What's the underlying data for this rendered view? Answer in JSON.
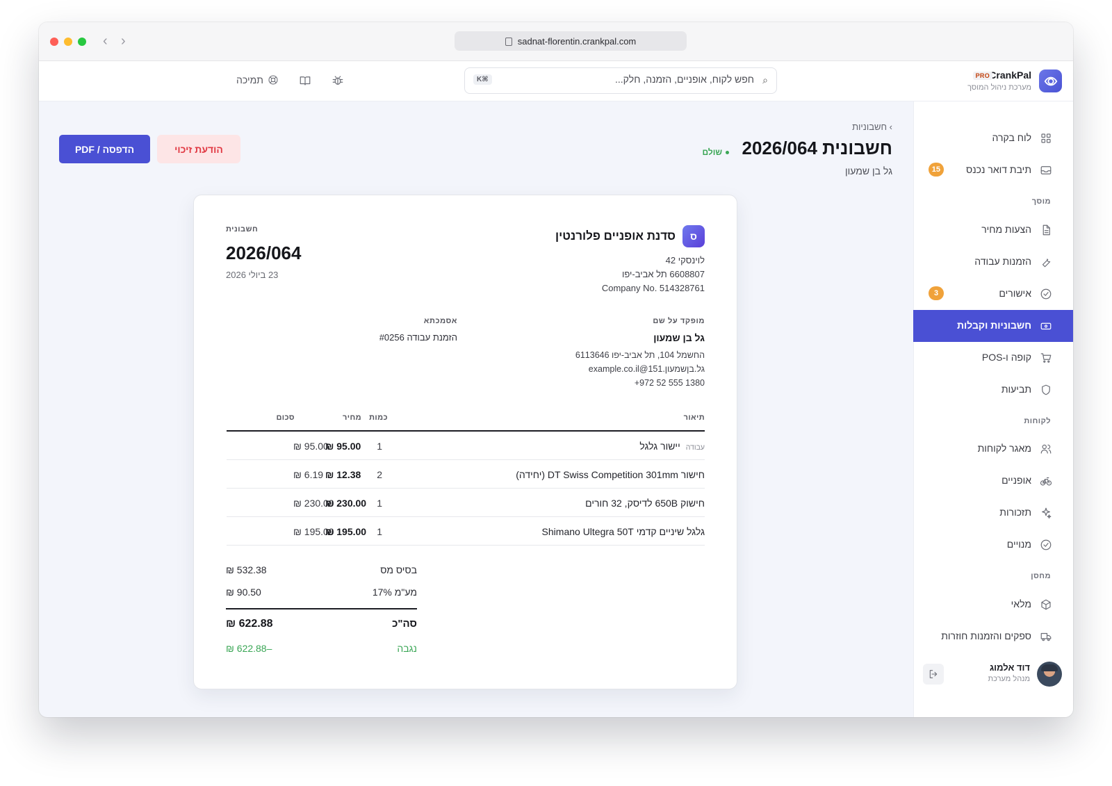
{
  "browser": {
    "url": "sadnat-florentin.crankpal.com"
  },
  "header": {
    "brand_name": "CrankPal",
    "brand_badge": "PRO",
    "brand_subtitle": "מערכת ניהול המוסך",
    "search_placeholder": "חפש לקוח, אופניים, הזמנה, חלק...",
    "search_shortcut": "⌘K",
    "support_label": "תמיכה"
  },
  "sidebar": {
    "items": [
      {
        "label": "לוח בקרה",
        "icon": "dashboard-grid-icon"
      },
      {
        "label": "תיבת דואר נכנס",
        "icon": "inbox-icon",
        "badge": "15"
      },
      {
        "label": "הצעות מחיר",
        "icon": "document-icon"
      },
      {
        "label": "הזמנות עבודה",
        "icon": "wrench-icon"
      },
      {
        "label": "אישורים",
        "icon": "check-circle-icon",
        "badge": "3"
      },
      {
        "label": "חשבוניות וקבלות",
        "icon": "cash-icon",
        "active": true
      },
      {
        "label": "קופה ו-POS",
        "icon": "cart-icon"
      },
      {
        "label": "תביעות",
        "icon": "shield-icon"
      },
      {
        "label": "מאגר לקוחות",
        "icon": "users-icon"
      },
      {
        "label": "אופניים",
        "icon": "bicycle-icon"
      },
      {
        "label": "תזכורות",
        "icon": "sparkle-icon"
      },
      {
        "label": "מנויים",
        "icon": "check-circle-icon"
      },
      {
        "label": "מלאי",
        "icon": "box-icon"
      },
      {
        "label": "ספקים והזמנות חוזרות",
        "icon": "truck-icon"
      }
    ],
    "sections": {
      "garage": "מוסך",
      "customers": "לקוחות",
      "warehouse": "מחסן"
    },
    "user": {
      "name": "דוד אלמוג",
      "role": "מנהל מערכת"
    }
  },
  "page": {
    "breadcrumb": "› חשבוניות",
    "title": "חשבונית 2026/064",
    "status": "שולם",
    "subtitle": "גל בן שמעון",
    "credit_button": "הודעת זיכוי",
    "print_button": "הדפסה / PDF"
  },
  "invoice": {
    "business": {
      "logo_letter": "ס",
      "name": "סדנת אופניים פלורנטין",
      "address_line1": "לוינסקי 42",
      "address_line2": "6608807 תל אביב-יפו",
      "company_no": "Company No. 514328761"
    },
    "label": "חשבונית",
    "number": "2026/064",
    "date": "23 ביולי 2026",
    "issued_to_label": "מופקד על שם",
    "customer": {
      "name": "גל בן שמעון",
      "address": "החשמל 104, תל אביב-יפו 6113646",
      "email": "גל.בןשמעון.151@example.co.il",
      "phone": "+972 52 555 1380"
    },
    "reference_label": "אסמכתא",
    "reference_value": "הזמנת עבודה #0256",
    "columns": {
      "description": "תיאור",
      "quantity": "כמות",
      "price": "מחיר",
      "amount": "סכום"
    },
    "lines": [
      {
        "tag": "עבודה",
        "description": "יישור גלגל",
        "quantity": "1",
        "price": "₪ 95.00",
        "amount": "₪ 95.00"
      },
      {
        "tag": "",
        "description": "חישור DT Swiss Competition 301mm (יחידה)",
        "quantity": "2",
        "price": "₪ 6.19",
        "amount": "₪ 12.38"
      },
      {
        "tag": "",
        "description": "חישוק 650B לדיסק, 32 חורים",
        "quantity": "1",
        "price": "₪ 230.00",
        "amount": "₪ 230.00"
      },
      {
        "tag": "",
        "description": "גלגל שיניים קדמי Shimano Ultegra 50T",
        "quantity": "1",
        "price": "₪ 195.00",
        "amount": "₪ 195.00"
      }
    ],
    "totals": {
      "tax_base_label": "בסיס מס",
      "tax_base_value": "₪ 532.38",
      "vat_label": "מע\"מ 17%",
      "vat_value": "₪ 90.50",
      "total_label": "סה\"כ",
      "total_value": "₪ 622.88",
      "paid_label": "נגבה",
      "paid_value": "₪ 622.88–"
    }
  },
  "colors": {
    "accent": "#4a50d4",
    "paid_green": "#3aa655",
    "credit_red": "#e13a44",
    "badge_orange": "#f0a23a"
  }
}
